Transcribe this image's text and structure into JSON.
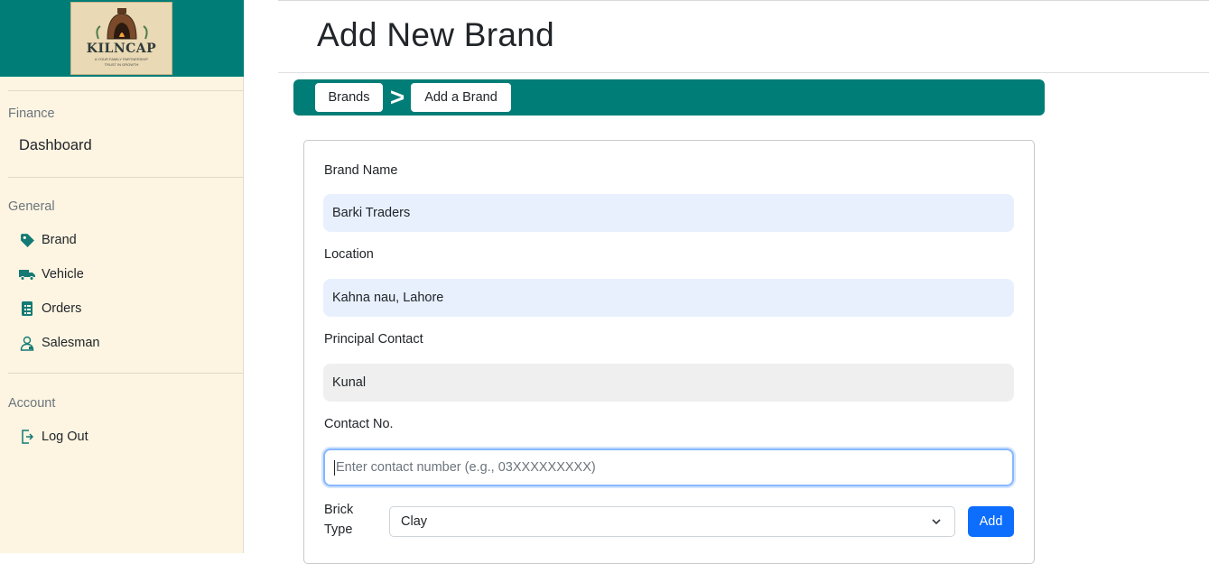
{
  "sidebar": {
    "logo": {
      "name": "KILNCAP",
      "tagline": "A YOUR FAMILY PARTNERSHIP",
      "tagline2": "TRUST IN GROWTH"
    },
    "sections": [
      {
        "title": "Finance",
        "items": [
          {
            "label": "Dashboard"
          }
        ]
      },
      {
        "title": "General",
        "items": [
          {
            "label": "Brand",
            "icon": "tag-icon"
          },
          {
            "label": "Vehicle",
            "icon": "truck-icon"
          },
          {
            "label": "Orders",
            "icon": "list-icon"
          },
          {
            "label": "Salesman",
            "icon": "user-icon"
          }
        ]
      },
      {
        "title": "Account",
        "items": [
          {
            "label": "Log Out",
            "icon": "logout-icon"
          }
        ]
      }
    ],
    "accent_color": "#007d77"
  },
  "header": {
    "title": "Add New Brand"
  },
  "breadcrumb": {
    "items": [
      "Brands",
      "Add a Brand"
    ],
    "separator": ">"
  },
  "form": {
    "brand_name": {
      "label": "Brand Name",
      "value": "Barki Traders"
    },
    "location": {
      "label": "Location",
      "value": "Kahna nau, Lahore"
    },
    "principal_contact": {
      "label": "Principal Contact",
      "value": "Kunal"
    },
    "contact_no": {
      "label": "Contact No.",
      "value": "",
      "placeholder": "Enter contact number (e.g., 03XXXXXXXXX)"
    },
    "brick_type": {
      "label_line1": "Brick",
      "label_line2": "Type",
      "selected": "Clay"
    },
    "add_button": "Add"
  }
}
